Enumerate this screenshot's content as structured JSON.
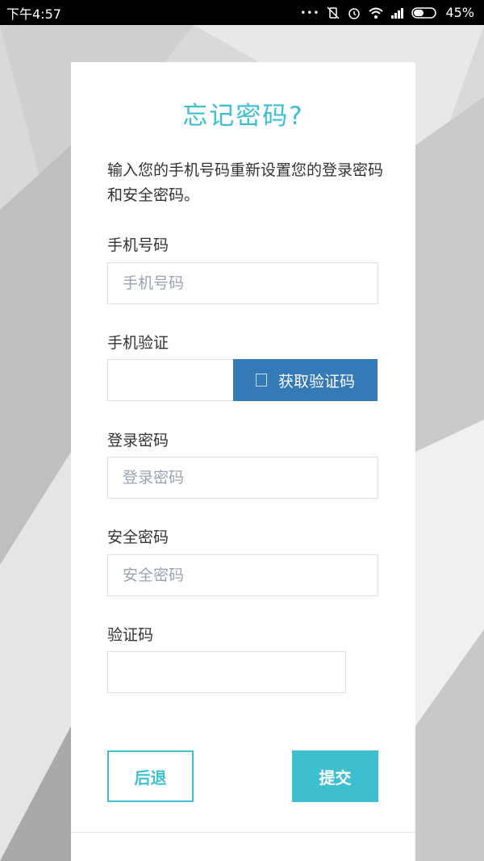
{
  "status_bar": {
    "time": "下午4:57",
    "dots": "•••",
    "battery": "45%"
  },
  "form": {
    "title": "忘记密码?",
    "intro": "输入您的手机号码重新设置您的登录密码和安全密码。",
    "phone": {
      "label": "手机号码",
      "placeholder": "手机号码"
    },
    "sms": {
      "label": "手机验证",
      "button_label": "获取验证码"
    },
    "login_password": {
      "label": "登录密码",
      "placeholder": "登录密码"
    },
    "security_password": {
      "label": "安全密码",
      "placeholder": "安全密码"
    },
    "captcha": {
      "label": "验证码"
    },
    "back_label": "后退",
    "submit_label": "提交"
  },
  "colors": {
    "accent": "#3ebfcf",
    "code_button": "#337ab7"
  }
}
